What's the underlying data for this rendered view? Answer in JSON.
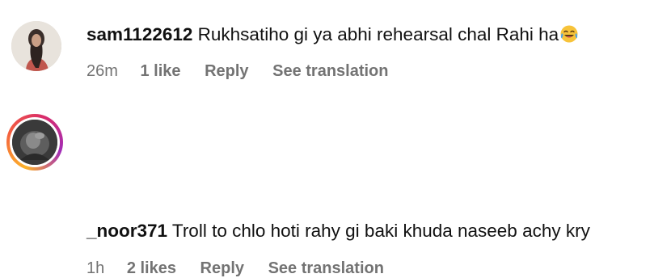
{
  "comments": [
    {
      "username": "sam1122612",
      "text": "Rukhsatiho gi ya abhi rehearsal chal Rahi ha",
      "emoji": "face-with-tears-of-joy",
      "time": "26m",
      "likes": "1 like",
      "reply_label": "Reply",
      "translate_label": "See translation",
      "has_story_ring": false
    },
    {
      "username": "_noor371",
      "text": "Troll to chlo hoti rahy gi baki khuda naseeb achy kry",
      "time": "1h",
      "likes": "2 likes",
      "reply_label": "Reply",
      "translate_label": "See translation",
      "has_story_ring": true
    }
  ],
  "colors": {
    "text_primary": "#111111",
    "text_secondary": "#737373",
    "story_ring_gradient": [
      "#fdb32a",
      "#f4603e",
      "#d92c6b",
      "#a12cb8"
    ]
  }
}
